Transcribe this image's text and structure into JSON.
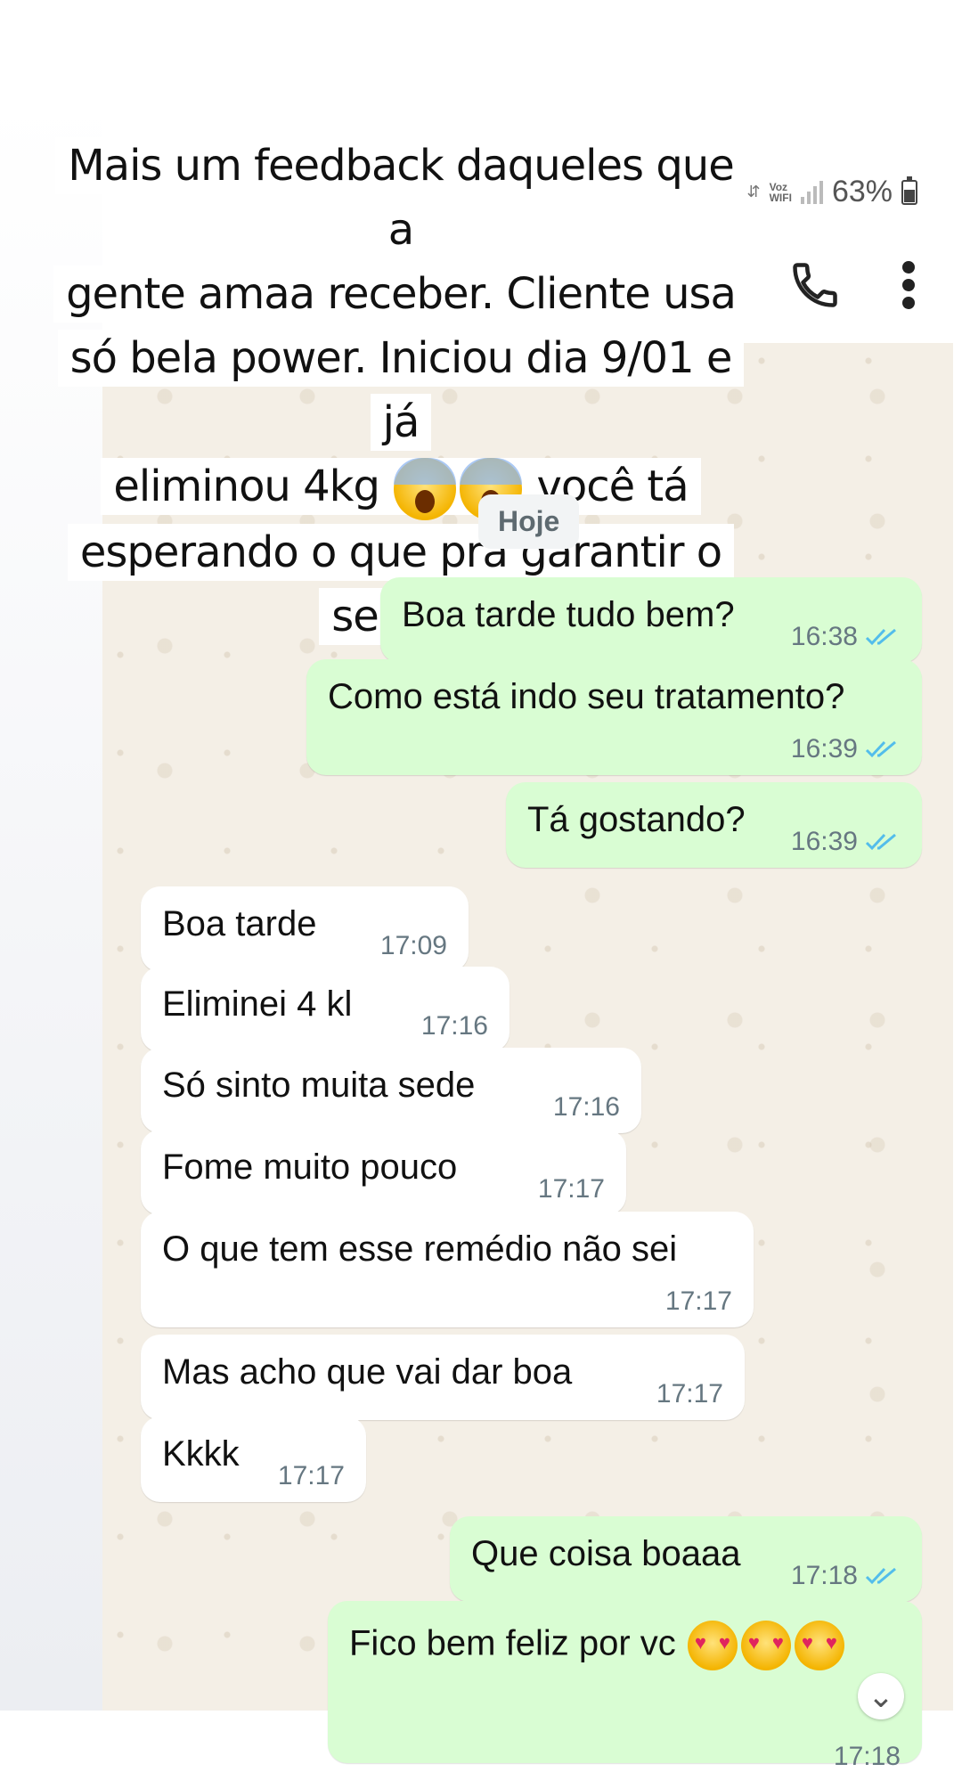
{
  "story": {
    "caption_line1": "Mais um feedback daqueles que a",
    "caption_line2": "gente amaa receber. Cliente usa",
    "caption_line3": "só bela power. Iniciou dia 9/01 e já",
    "caption_line4_a": "eliminou 4kg",
    "caption_line4_b": "você tá",
    "caption_line5": "esperando o que pra garantir o",
    "caption_line6": "seu???",
    "emojis": [
      "face-screaming-in-fear",
      "face-screaming-in-fear"
    ]
  },
  "status_bar": {
    "voz_label": "Voz",
    "wifi_label": "WIFI",
    "battery": "63%"
  },
  "header": {
    "icons": [
      "phone-icon",
      "more-vertical-icon"
    ]
  },
  "chat": {
    "day_label": "Hoje",
    "messages": [
      {
        "dir": "out",
        "text": "Boa tarde tudo bem?",
        "time": "16:38"
      },
      {
        "dir": "out",
        "text": "Como está indo seu tratamento?",
        "time": "16:39"
      },
      {
        "dir": "out",
        "text": "Tá gostando?",
        "time": "16:39"
      },
      {
        "dir": "in",
        "text": "Boa tarde",
        "time": "17:09"
      },
      {
        "dir": "in",
        "text": "Eliminei 4 kl",
        "time": "17:16"
      },
      {
        "dir": "in",
        "text": "Só sinto muita sede",
        "time": "17:16"
      },
      {
        "dir": "in",
        "text": "Fome muito pouco",
        "time": "17:17"
      },
      {
        "dir": "in",
        "text": "O que tem esse remédio não sei",
        "time": "17:17"
      },
      {
        "dir": "in",
        "text": "Mas acho que vai dar boa",
        "time": "17:17"
      },
      {
        "dir": "in",
        "text": "Kkkk",
        "time": "17:17"
      },
      {
        "dir": "out",
        "text": "Que coisa boaaa",
        "time": "17:18"
      },
      {
        "dir": "out",
        "text": "Fico bem feliz por vc",
        "time": "17:18"
      }
    ]
  },
  "colors": {
    "outgoing_bubble": "#d9fdd3",
    "incoming_bubble": "#ffffff",
    "chat_background": "#f4efe6",
    "read_ticks": "#53bdeb"
  }
}
